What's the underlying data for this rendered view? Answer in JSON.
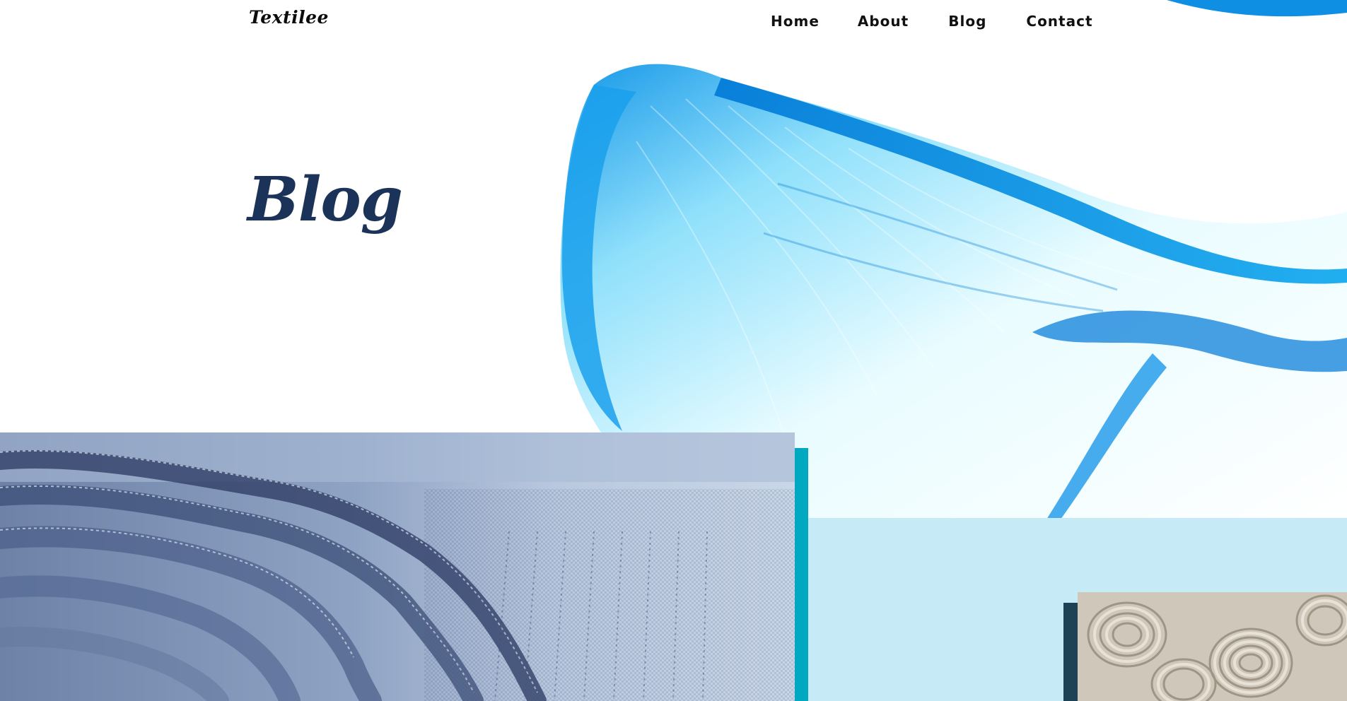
{
  "brand": {
    "logo_text": "Textilee"
  },
  "nav": {
    "items": [
      {
        "label": "Home"
      },
      {
        "label": "About"
      },
      {
        "label": "Blog"
      },
      {
        "label": "Contact"
      }
    ]
  },
  "hero": {
    "title": "Blog"
  },
  "colors": {
    "title": "#1b3358",
    "teal_bar": "#00a9bf",
    "light_panel": "#c6ebf7",
    "dark_bar": "#1d4256",
    "ribbon": "#0a8fe0"
  },
  "images": {
    "hero": "blue-fabric-ribbon-image",
    "denim": "folded-denim-fabric-photo",
    "rolls": "rolled-fabric-bolts-photo"
  }
}
